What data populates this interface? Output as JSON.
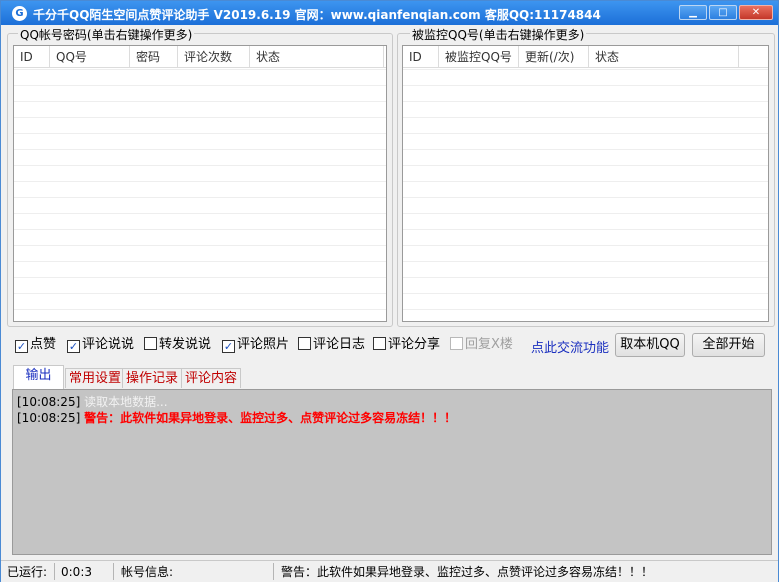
{
  "window": {
    "title": "千分千QQ陌生空间点赞评论助手 V2019.6.19 官网：www.qianfenqian.com 客服QQ:11174844",
    "app_icon": "G",
    "min_glyph": "▁",
    "max_glyph": "□",
    "close_glyph": "✕"
  },
  "left_group": {
    "title": "QQ帐号密码(单击右键操作更多)",
    "columns": [
      "ID",
      "QQ号",
      "密码",
      "评论次数",
      "状态"
    ]
  },
  "right_group": {
    "title": "被监控QQ号(单击右键操作更多)",
    "columns": [
      "ID",
      "被监控QQ号",
      "更新(/次)",
      "状态"
    ]
  },
  "options": [
    {
      "label": "点赞",
      "checked": true,
      "enabled": true
    },
    {
      "label": "评论说说",
      "checked": true,
      "enabled": true
    },
    {
      "label": "转发说说",
      "checked": false,
      "enabled": true
    },
    {
      "label": "评论照片",
      "checked": true,
      "enabled": true
    },
    {
      "label": "评论日志",
      "checked": false,
      "enabled": true
    },
    {
      "label": "评论分享",
      "checked": false,
      "enabled": true
    },
    {
      "label": "回复X楼",
      "checked": false,
      "enabled": false
    }
  ],
  "exchange_link": "点此交流功能",
  "buttons": {
    "get_local_qq": "取本机QQ",
    "start_all": "全部开始"
  },
  "tabs": [
    "输出",
    "常用设置",
    "操作记录",
    "评论内容"
  ],
  "log": [
    {
      "time": "[10:08:25]",
      "text": "读取本地数据...",
      "style": "gray"
    },
    {
      "time": "[10:08:25]",
      "text": "警告：此软件如果异地登录、监控过多、点赞评论过多容易冻结！！！",
      "style": "red"
    }
  ],
  "status": {
    "running_label": "已运行:",
    "running_value": "0:0:3",
    "account_label": "帐号信息:",
    "account_value": "",
    "warning": "警告：此软件如果异地登录、监控过多、点赞评论过多容易冻结！！！"
  },
  "colors": {
    "titlebar": "#1c6fd8",
    "log_bg": "#c4c4c4",
    "warning_red": "#ff0000",
    "tab_inactive_text": "#c00000",
    "link_blue": "#1a2fbf"
  }
}
